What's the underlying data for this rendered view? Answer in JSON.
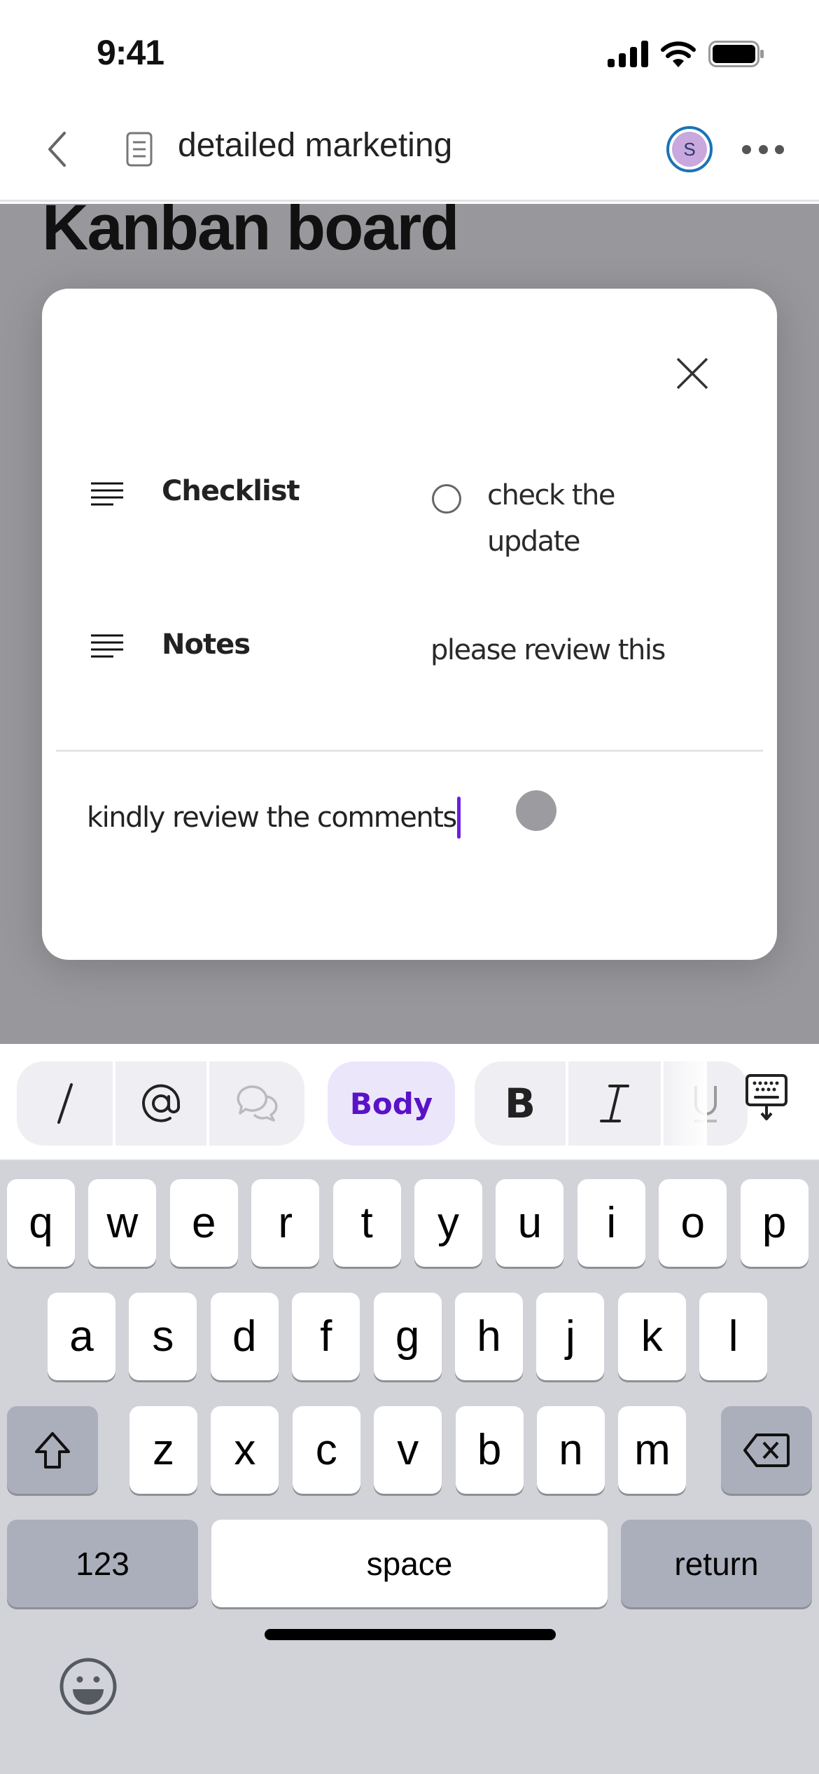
{
  "status_bar": {
    "time": "9:41",
    "icons": [
      "cellular-signal-icon",
      "wifi-icon",
      "battery-icon"
    ]
  },
  "nav": {
    "back_icon": "chevron-left-icon",
    "doc_icon": "document-icon",
    "title": "detailed marketing",
    "avatar_initial": "S",
    "more_icon": "ellipsis-icon"
  },
  "page": {
    "title": "Kanban board"
  },
  "modal": {
    "close_icon": "close-icon",
    "properties": [
      {
        "icon": "text-lines-icon",
        "label": "Checklist",
        "type": "checklist",
        "items": [
          {
            "text": "check the update",
            "checked": false
          }
        ]
      },
      {
        "icon": "text-lines-icon",
        "label": "Notes",
        "type": "text",
        "value": "please review this"
      }
    ],
    "comment": {
      "value": "kindly review the comments",
      "focused": true
    }
  },
  "toolbar": {
    "slash_label": "/",
    "mention_label": "@",
    "comment_icon": "comments-icon",
    "style_label": "Body",
    "bold_label": "B",
    "italic_label": "I",
    "underline_label": "U",
    "dismiss_icon": "keyboard-dismiss-icon",
    "accent_color": "#5a12c8"
  },
  "keyboard": {
    "row1": [
      "q",
      "w",
      "e",
      "r",
      "t",
      "y",
      "u",
      "i",
      "o",
      "p"
    ],
    "row2": [
      "a",
      "s",
      "d",
      "f",
      "g",
      "h",
      "j",
      "k",
      "l"
    ],
    "row3": [
      "z",
      "x",
      "c",
      "v",
      "b",
      "n",
      "m"
    ],
    "shift_icon": "shift-icon",
    "delete_icon": "backspace-icon",
    "numbers_label": "123",
    "space_label": "space",
    "return_label": "return",
    "emoji_icon": "emoji-icon"
  }
}
